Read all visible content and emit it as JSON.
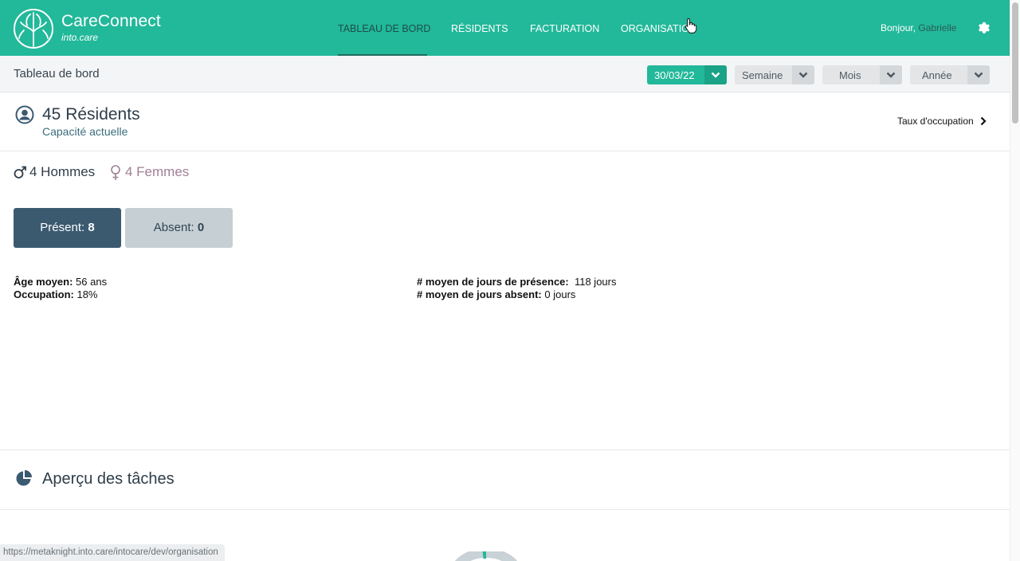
{
  "brand": {
    "name": "CareConnect",
    "sub": "into.care"
  },
  "nav": [
    {
      "label": "TABLEAU DE BORD",
      "active": true
    },
    {
      "label": "RÉSIDENTS"
    },
    {
      "label": "FACTURATION"
    },
    {
      "label": "ORGANISATION"
    }
  ],
  "greeting": {
    "prefix": "Bonjour,",
    "name": "Gabrielle"
  },
  "subheader": {
    "title": "Tableau de bord",
    "date": "30/03/22",
    "periods": [
      "Semaine",
      "Mois",
      "Année"
    ]
  },
  "residents": {
    "title": "45 Résidents",
    "subtitle": "Capacité actuelle",
    "occupancy_link": "Taux d'occupation",
    "men": "4 Hommes",
    "women": "4 Femmes",
    "present_label": "Présent:",
    "present_value": "8",
    "absent_label": "Absent:",
    "absent_value": "0"
  },
  "stats": {
    "avg_age_label": "Âge moyen:",
    "avg_age_value": "56 ans",
    "occupation_label": "Occupation:",
    "occupation_value": "18%",
    "presence_label": "# moyen de jours de présence:",
    "presence_value": "118 jours",
    "absent_days_label": "# moyen de jours absent:",
    "absent_days_value": "0 jours"
  },
  "tasks": {
    "title": "Aperçu des tâches"
  },
  "status_url": "https://metaknight.into.care/intocare/dev/organisation",
  "colors": {
    "primary": "#22b89a",
    "dark": "#3b5a70",
    "absent": "#c6cfd3",
    "female": "#a07f95"
  }
}
